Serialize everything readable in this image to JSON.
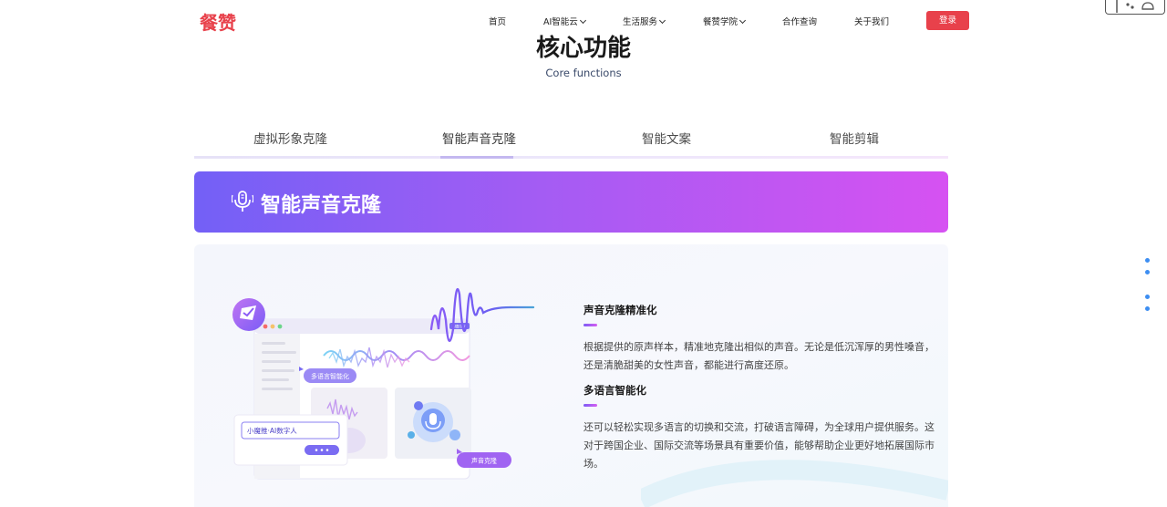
{
  "header": {
    "logo": "餐赞",
    "nav": [
      {
        "label": "首页",
        "has_dropdown": false
      },
      {
        "label": "AI智能云",
        "has_dropdown": true
      },
      {
        "label": "生活服务",
        "has_dropdown": true
      },
      {
        "label": "餐赞学院",
        "has_dropdown": true
      },
      {
        "label": "合作查询",
        "has_dropdown": false
      },
      {
        "label": "关于我们",
        "has_dropdown": false
      }
    ],
    "login_label": "登录"
  },
  "section": {
    "title": "核心功能",
    "subtitle": "Core functions"
  },
  "tabs": [
    {
      "label": "虚拟形象克隆",
      "active": false
    },
    {
      "label": "智能声音克隆",
      "active": true
    },
    {
      "label": "智能文案",
      "active": false
    },
    {
      "label": "智能剪辑",
      "active": false
    }
  ],
  "banner": {
    "title": "智能声音克隆",
    "icon": "microphone-icon"
  },
  "features": [
    {
      "title": "声音克隆精准化",
      "desc_lines": [
        "根据提供的原声样本，精准地克隆出相似的声音。无论是低沉浑厚的男性嗓音，",
        "还是清脆甜美的女性声音，都能进行高度还原。"
      ]
    },
    {
      "title": "多语言智能化",
      "desc_lines": [
        "还可以轻松实现多语言的切换和交流，打破语言障碍，为全球用户提供服务。这",
        "对于跨国企业、国际交流等场景具有重要价值，能够帮助企业更好地拓展国际市",
        "场。"
      ]
    }
  ],
  "illustration": {
    "tag_multilang": "多语言智能化",
    "tag_voice_clone": "声音克隆",
    "input_text": "小魔推·AI数字人",
    "window_badge": "AI数字人"
  },
  "colors": {
    "brand": "#e8414b",
    "banner_start": "#7360f6",
    "banner_end": "#d652f2",
    "side_dots": "#3d8ef2"
  }
}
